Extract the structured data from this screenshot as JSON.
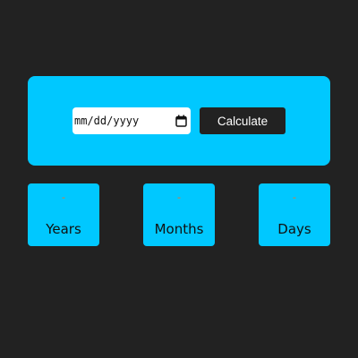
{
  "form": {
    "date_placeholder": "mm/dd/yyyy",
    "calculate_label": "Calculate",
    "calendar_icon": "calendar-icon"
  },
  "results": {
    "years": {
      "value": "-",
      "label": "Years"
    },
    "months": {
      "value": "-",
      "label": "Months"
    },
    "days": {
      "value": "-",
      "label": "Days"
    }
  },
  "colors": {
    "background": "#222222",
    "panel": "#00c8ff",
    "button": "#222222",
    "value_text": "#ff6a1a"
  }
}
